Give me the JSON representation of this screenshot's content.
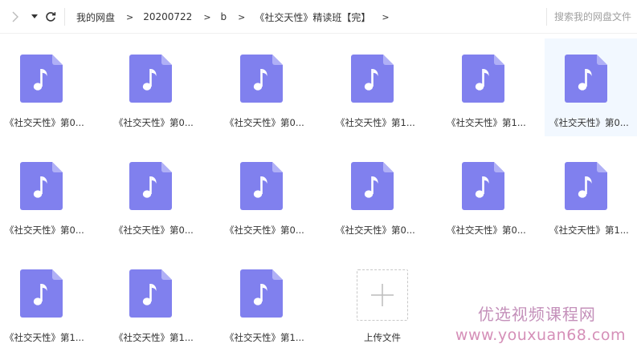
{
  "breadcrumb": [
    "我的网盘",
    "20200722",
    "b",
    "《社交天性》精读班【完】"
  ],
  "breadcrumb_sep": ">",
  "search": {
    "placeholder": "搜索我的网盘文件"
  },
  "files": [
    {
      "label": "《社交天性》第0..."
    },
    {
      "label": "《社交天性》第0..."
    },
    {
      "label": "《社交天性》第0..."
    },
    {
      "label": "《社交天性》第1..."
    },
    {
      "label": "《社交天性》第1..."
    },
    {
      "label": "《社交天性》第0...",
      "selected": true
    },
    {
      "label": "《社交天性》第0..."
    },
    {
      "label": "《社交天性》第0..."
    },
    {
      "label": "《社交天性》第0..."
    },
    {
      "label": "《社交天性》第0..."
    },
    {
      "label": "《社交天性》第0..."
    },
    {
      "label": "《社交天性》第1..."
    },
    {
      "label": "《社交天性》第1..."
    },
    {
      "label": "《社交天性》第1..."
    },
    {
      "label": "《社交天性》第1..."
    }
  ],
  "upload": {
    "label": "上传文件"
  },
  "watermark": {
    "name": "优选视频课程网",
    "url": "www.youxuan68.com"
  },
  "colors": {
    "file_icon": "#8080ee",
    "file_icon_fold": "#b0b0f6",
    "selected_bg": "#f2f8ff",
    "watermark": "#c490ba"
  },
  "icons": {
    "file": "music-note-file-icon",
    "upload": "plus-icon"
  }
}
